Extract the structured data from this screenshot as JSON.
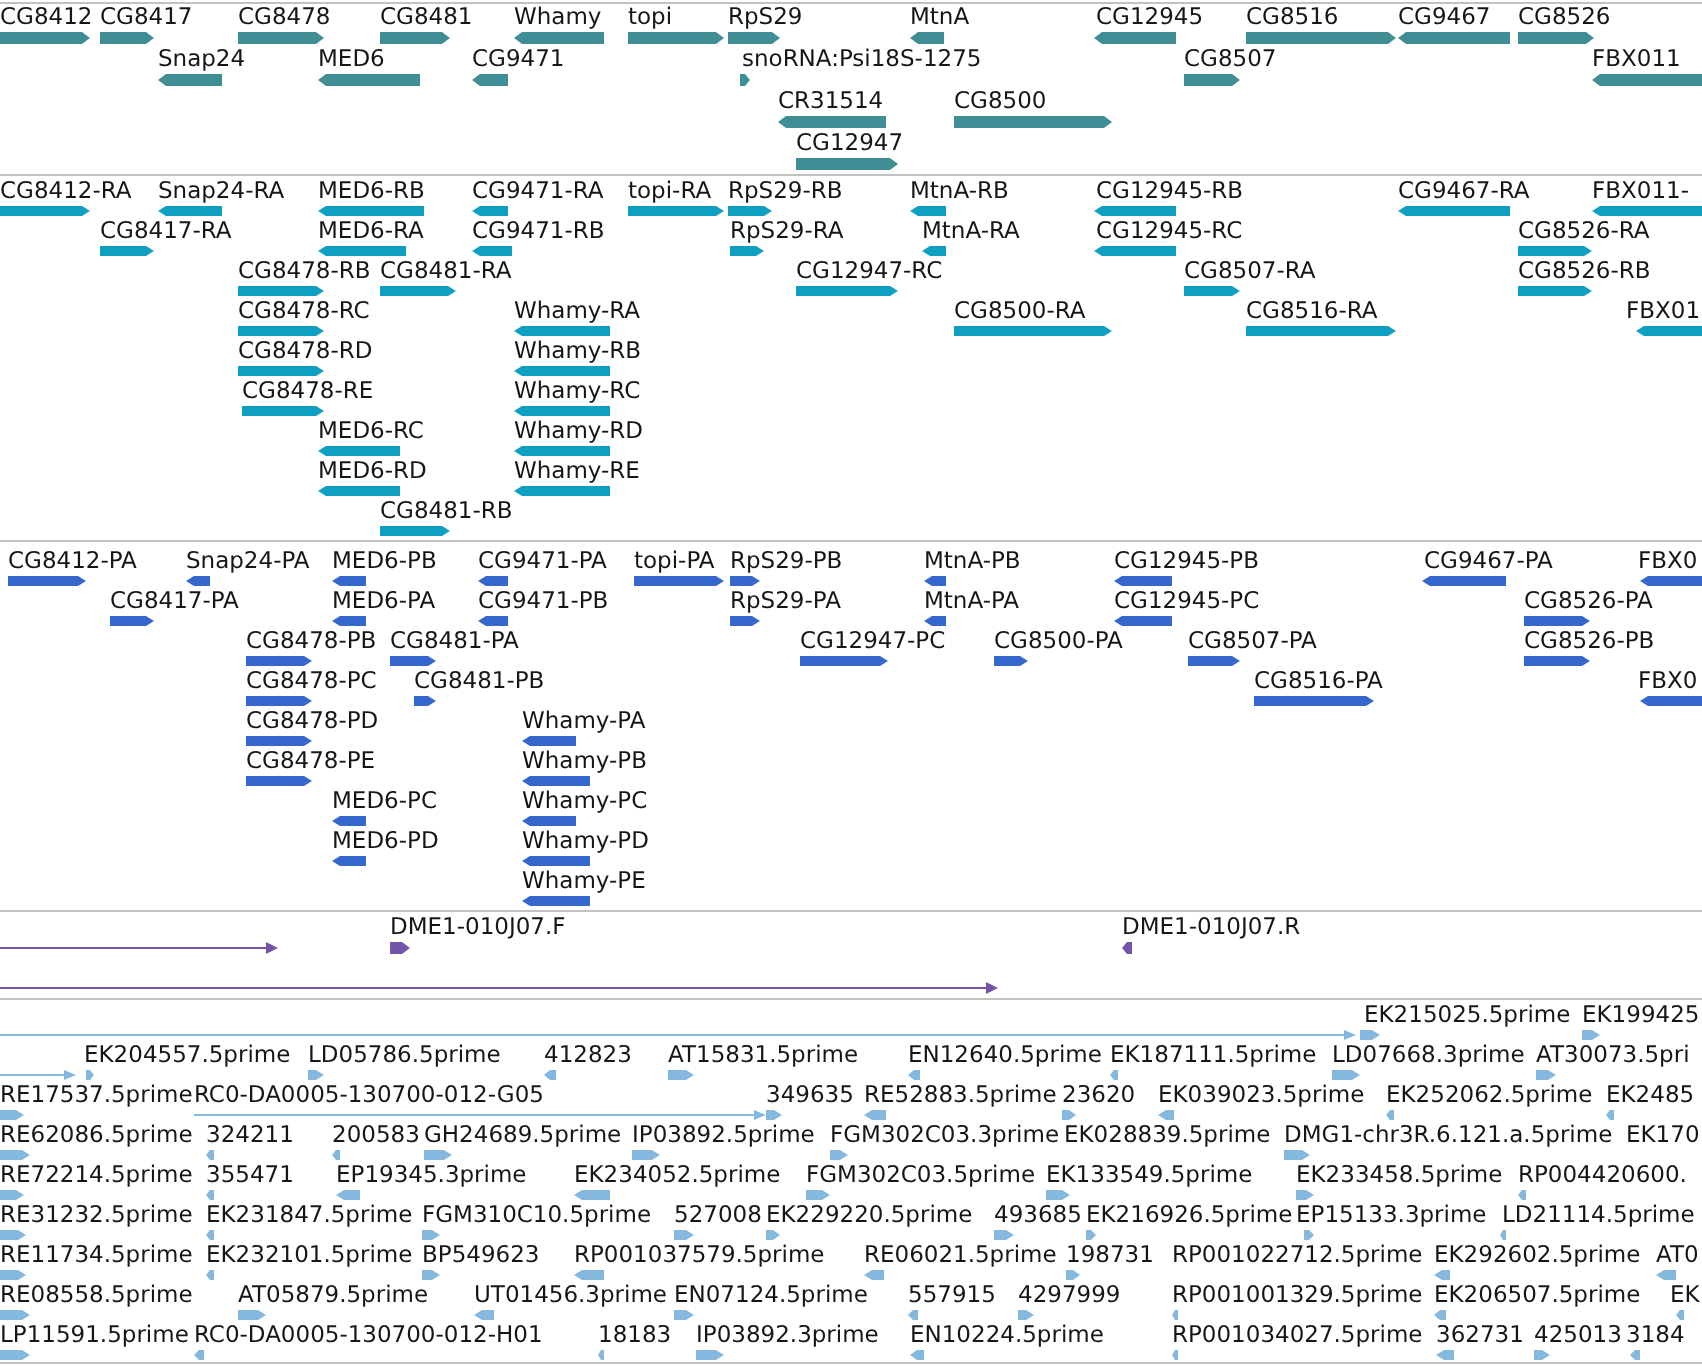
{
  "tracks": [
    {
      "kind": "gene",
      "features": [
        {
          "label": "CG8412",
          "reverse_strand": false
        },
        {
          "label": "CG8417",
          "reverse_strand": false
        },
        {
          "label": "CG8478",
          "reverse_strand": false
        },
        {
          "label": "CG8481",
          "reverse_strand": false
        },
        {
          "label": "Whamy",
          "reverse_strand": true
        },
        {
          "label": "topi",
          "reverse_strand": false
        },
        {
          "label": "RpS29",
          "reverse_strand": false
        },
        {
          "label": "MtnA",
          "reverse_strand": true
        },
        {
          "label": "CG12945",
          "reverse_strand": true
        },
        {
          "label": "CG8516",
          "reverse_strand": false
        },
        {
          "label": "CG9467",
          "reverse_strand": true
        },
        {
          "label": "CG8526",
          "reverse_strand": false
        },
        {
          "label": "Snap24",
          "reverse_strand": true
        },
        {
          "label": "MED6",
          "reverse_strand": true
        },
        {
          "label": "CG9471",
          "reverse_strand": true
        },
        {
          "label": "snoRNA:Psi18S-1275",
          "reverse_strand": false
        },
        {
          "label": "CG8507",
          "reverse_strand": false
        },
        {
          "label": "FBX011",
          "reverse_strand": true
        },
        {
          "label": "CR31514",
          "reverse_strand": true
        },
        {
          "label": "CG8500",
          "reverse_strand": false
        },
        {
          "label": "CG12947",
          "reverse_strand": false
        }
      ]
    },
    {
      "kind": "transcript",
      "features": [
        {
          "label": "CG8412-RA",
          "reverse_strand": false
        },
        {
          "label": "Snap24-RA",
          "reverse_strand": true
        },
        {
          "label": "MED6-RB",
          "reverse_strand": true
        },
        {
          "label": "CG9471-RA",
          "reverse_strand": true
        },
        {
          "label": "topi-RA",
          "reverse_strand": false
        },
        {
          "label": "RpS29-RB",
          "reverse_strand": false
        },
        {
          "label": "MtnA-RB",
          "reverse_strand": true
        },
        {
          "label": "CG12945-RB",
          "reverse_strand": true
        },
        {
          "label": "CG9467-RA",
          "reverse_strand": true
        },
        {
          "label": "FBX011-",
          "reverse_strand": true
        },
        {
          "label": "CG8417-RA",
          "reverse_strand": false
        },
        {
          "label": "MED6-RA",
          "reverse_strand": true
        },
        {
          "label": "CG9471-RB",
          "reverse_strand": true
        },
        {
          "label": "RpS29-RA",
          "reverse_strand": false
        },
        {
          "label": "MtnA-RA",
          "reverse_strand": true
        },
        {
          "label": "CG12945-RC",
          "reverse_strand": true
        },
        {
          "label": "CG8526-RA",
          "reverse_strand": false
        },
        {
          "label": "CG8478-RB",
          "reverse_strand": false
        },
        {
          "label": "CG8481-RA",
          "reverse_strand": false
        },
        {
          "label": "CG12947-RC",
          "reverse_strand": false
        },
        {
          "label": "CG8507-RA",
          "reverse_strand": false
        },
        {
          "label": "CG8526-RB",
          "reverse_strand": false
        },
        {
          "label": "CG8478-RC",
          "reverse_strand": false
        },
        {
          "label": "Whamy-RA",
          "reverse_strand": true
        },
        {
          "label": "CG8500-RA",
          "reverse_strand": false
        },
        {
          "label": "CG8516-RA",
          "reverse_strand": false
        },
        {
          "label": "FBX01",
          "reverse_strand": true
        },
        {
          "label": "CG8478-RD",
          "reverse_strand": false
        },
        {
          "label": "Whamy-RB",
          "reverse_strand": true
        },
        {
          "label": "CG8478-RE",
          "reverse_strand": false
        },
        {
          "label": "Whamy-RC",
          "reverse_strand": true
        },
        {
          "label": "MED6-RC",
          "reverse_strand": true
        },
        {
          "label": "Whamy-RD",
          "reverse_strand": true
        },
        {
          "label": "MED6-RD",
          "reverse_strand": true
        },
        {
          "label": "Whamy-RE",
          "reverse_strand": true
        },
        {
          "label": "CG8481-RB",
          "reverse_strand": false
        }
      ]
    },
    {
      "kind": "translation",
      "features": [
        {
          "label": "CG8412-PA",
          "reverse_strand": false
        },
        {
          "label": "Snap24-PA",
          "reverse_strand": true
        },
        {
          "label": "MED6-PB",
          "reverse_strand": true
        },
        {
          "label": "CG9471-PA",
          "reverse_strand": true
        },
        {
          "label": "topi-PA",
          "reverse_strand": false
        },
        {
          "label": "RpS29-PB",
          "reverse_strand": false
        },
        {
          "label": "MtnA-PB",
          "reverse_strand": true
        },
        {
          "label": "CG12945-PB",
          "reverse_strand": true
        },
        {
          "label": "CG9467-PA",
          "reverse_strand": true
        },
        {
          "label": "FBX0",
          "reverse_strand": true
        },
        {
          "label": "CG8417-PA",
          "reverse_strand": false
        },
        {
          "label": "MED6-PA",
          "reverse_strand": true
        },
        {
          "label": "CG9471-PB",
          "reverse_strand": true
        },
        {
          "label": "RpS29-PA",
          "reverse_strand": false
        },
        {
          "label": "MtnA-PA",
          "reverse_strand": true
        },
        {
          "label": "CG12945-PC",
          "reverse_strand": true
        },
        {
          "label": "CG8526-PA",
          "reverse_strand": false
        },
        {
          "label": "CG8478-PB",
          "reverse_strand": false
        },
        {
          "label": "CG8481-PA",
          "reverse_strand": false
        },
        {
          "label": "CG12947-PC",
          "reverse_strand": false
        },
        {
          "label": "CG8500-PA",
          "reverse_strand": false
        },
        {
          "label": "CG8507-PA",
          "reverse_strand": false
        },
        {
          "label": "CG8526-PB",
          "reverse_strand": false
        },
        {
          "label": "CG8478-PC",
          "reverse_strand": false
        },
        {
          "label": "CG8481-PB",
          "reverse_strand": false
        },
        {
          "label": "CG8516-PA",
          "reverse_strand": false
        },
        {
          "label": "FBX0",
          "reverse_strand": true
        },
        {
          "label": "CG8478-PD",
          "reverse_strand": false
        },
        {
          "label": "Whamy-PA",
          "reverse_strand": true
        },
        {
          "label": "CG8478-PE",
          "reverse_strand": false
        },
        {
          "label": "Whamy-PB",
          "reverse_strand": true
        },
        {
          "label": "MED6-PC",
          "reverse_strand": true
        },
        {
          "label": "Whamy-PC",
          "reverse_strand": true
        },
        {
          "label": "MED6-PD",
          "reverse_strand": true
        },
        {
          "label": "Whamy-PD",
          "reverse_strand": true
        },
        {
          "label": "Whamy-PE",
          "reverse_strand": true
        }
      ]
    },
    {
      "kind": "bac_end",
      "features": [
        {
          "reverse_strand": false
        },
        {
          "label": "DME1-010J07.F",
          "reverse_strand": false
        },
        {
          "label": "DME1-010J07.R",
          "reverse_strand": true
        },
        {
          "reverse_strand": false
        }
      ]
    },
    {
      "kind": "est",
      "features": [
        {
          "reverse_strand": false
        },
        {
          "label": "EK215025.5prime",
          "reverse_strand": false
        },
        {
          "label": "EK199425",
          "reverse_strand": false
        },
        {
          "reverse_strand": false
        },
        {
          "label": "EK204557.5prime",
          "reverse_strand": false
        },
        {
          "label": "LD05786.5prime",
          "reverse_strand": false
        },
        {
          "label": "412823",
          "reverse_strand": true
        },
        {
          "label": "AT15831.5prime",
          "reverse_strand": false
        },
        {
          "label": "EN12640.5prime",
          "reverse_strand": true
        },
        {
          "label": "EK187111.5prime",
          "reverse_strand": true
        },
        {
          "label": "LD07668.3prime",
          "reverse_strand": false
        },
        {
          "label": "AT30073.5pri",
          "reverse_strand": false
        },
        {
          "label": "RE17537.5prime",
          "reverse_strand": false
        },
        {
          "label": "RC0-DA0005-130700-012-G05",
          "reverse_strand": false
        },
        {
          "label": "349635",
          "reverse_strand": false
        },
        {
          "label": "RE52883.5prime",
          "reverse_strand": true
        },
        {
          "label": "23620",
          "reverse_strand": false
        },
        {
          "label": "EK039023.5prime",
          "reverse_strand": true
        },
        {
          "label": "EK252062.5prime",
          "reverse_strand": true
        },
        {
          "label": "EK2485",
          "reverse_strand": true
        },
        {
          "label": "RE62086.5prime",
          "reverse_strand": false
        },
        {
          "label": "324211",
          "reverse_strand": true
        },
        {
          "label": "200583",
          "reverse_strand": true
        },
        {
          "label": "GH24689.5prime",
          "reverse_strand": false
        },
        {
          "label": "IP03892.5prime",
          "reverse_strand": false
        },
        {
          "label": "FGM302C03.3prime",
          "reverse_strand": false
        },
        {
          "label": "EK028839.5prime"
        },
        {
          "label": "DMG1-chr3R.6.121.a.5prime",
          "reverse_strand": false
        },
        {
          "label": "EK170"
        },
        {
          "label": "RE72214.5prime",
          "reverse_strand": false
        },
        {
          "label": "355471",
          "reverse_strand": true
        },
        {
          "label": "EP19345.3prime",
          "reverse_strand": true
        },
        {
          "label": "EK234052.5prime",
          "reverse_strand": true
        },
        {
          "label": "FGM302C03.5prime",
          "reverse_strand": false
        },
        {
          "label": "EK133549.5prime",
          "reverse_strand": false
        },
        {
          "label": "EK233458.5prime",
          "reverse_strand": false
        },
        {
          "label": "RP004420600.",
          "reverse_strand": true
        },
        {
          "label": "RE31232.5prime",
          "reverse_strand": false
        },
        {
          "label": "EK231847.5prime",
          "reverse_strand": true
        },
        {
          "label": "FGM310C10.5prime",
          "reverse_strand": false
        },
        {
          "label": "527008",
          "reverse_strand": false
        },
        {
          "label": "EK229220.5prime",
          "reverse_strand": false
        },
        {
          "label": "493685",
          "reverse_strand": false
        },
        {
          "label": "EK216926.5prime",
          "reverse_strand": false
        },
        {
          "label": "EP15133.3prime",
          "reverse_strand": false
        },
        {
          "label": "LD21114.5prime",
          "reverse_strand": true
        },
        {
          "label": "RE11734.5prime",
          "reverse_strand": false
        },
        {
          "label": "EK232101.5prime",
          "reverse_strand": true
        },
        {
          "label": "BP549623",
          "reverse_strand": false
        },
        {
          "label": "RP001037579.5prime",
          "reverse_strand": true
        },
        {
          "label": "RE06021.5prime",
          "reverse_strand": true
        },
        {
          "label": "198731",
          "reverse_strand": false
        },
        {
          "label": "RP001022712.5prime"
        },
        {
          "label": "EK292602.5prime",
          "reverse_strand": true
        },
        {
          "label": "AT0",
          "reverse_strand": true
        },
        {
          "label": "RE08558.5prime",
          "reverse_strand": false
        },
        {
          "label": "AT05879.5prime",
          "reverse_strand": false
        },
        {
          "label": "UT01456.3prime",
          "reverse_strand": true
        },
        {
          "label": "EN07124.5prime",
          "reverse_strand": false
        },
        {
          "label": "557915",
          "reverse_strand": true
        },
        {
          "label": "4297999",
          "reverse_strand": false
        },
        {
          "label": "RP001001329.5prime",
          "reverse_strand": true
        },
        {
          "label": "EK206507.5prime",
          "reverse_strand": true
        },
        {
          "label": "EK",
          "reverse_strand": true
        },
        {
          "label": "LP11591.5prime",
          "reverse_strand": false
        },
        {
          "label": "RC0-DA0005-130700-012-H01",
          "reverse_strand": true
        },
        {
          "label": "18183",
          "reverse_strand": true
        },
        {
          "label": "IP03892.3prime",
          "reverse_strand": false
        },
        {
          "label": "EN10224.5prime",
          "reverse_strand": true
        },
        {
          "label": "RP001034027.5prime",
          "reverse_strand": true
        },
        {
          "label": "362731",
          "reverse_strand": true
        },
        {
          "label": "425013",
          "reverse_strand": false
        },
        {
          "label": "3184",
          "reverse_strand": true
        }
      ]
    }
  ]
}
